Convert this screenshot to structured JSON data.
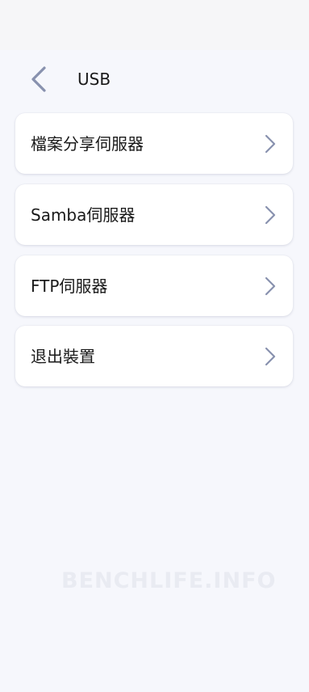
{
  "header": {
    "title": "USB",
    "back_icon": "chevron-left-icon"
  },
  "menu": {
    "items": [
      {
        "label": "檔案分享伺服器",
        "icon": "chevron-right-icon"
      },
      {
        "label": "Samba伺服器",
        "icon": "chevron-right-icon"
      },
      {
        "label": "FTP伺服器",
        "icon": "chevron-right-icon"
      },
      {
        "label": "退出裝置",
        "icon": "chevron-right-icon"
      }
    ]
  },
  "watermark": {
    "text": "BENCHLIFE.INFO"
  },
  "colors": {
    "background": "#f6f7fc",
    "card": "#ffffff",
    "chevron": "#8891ae",
    "text": "#1a1a1a"
  }
}
